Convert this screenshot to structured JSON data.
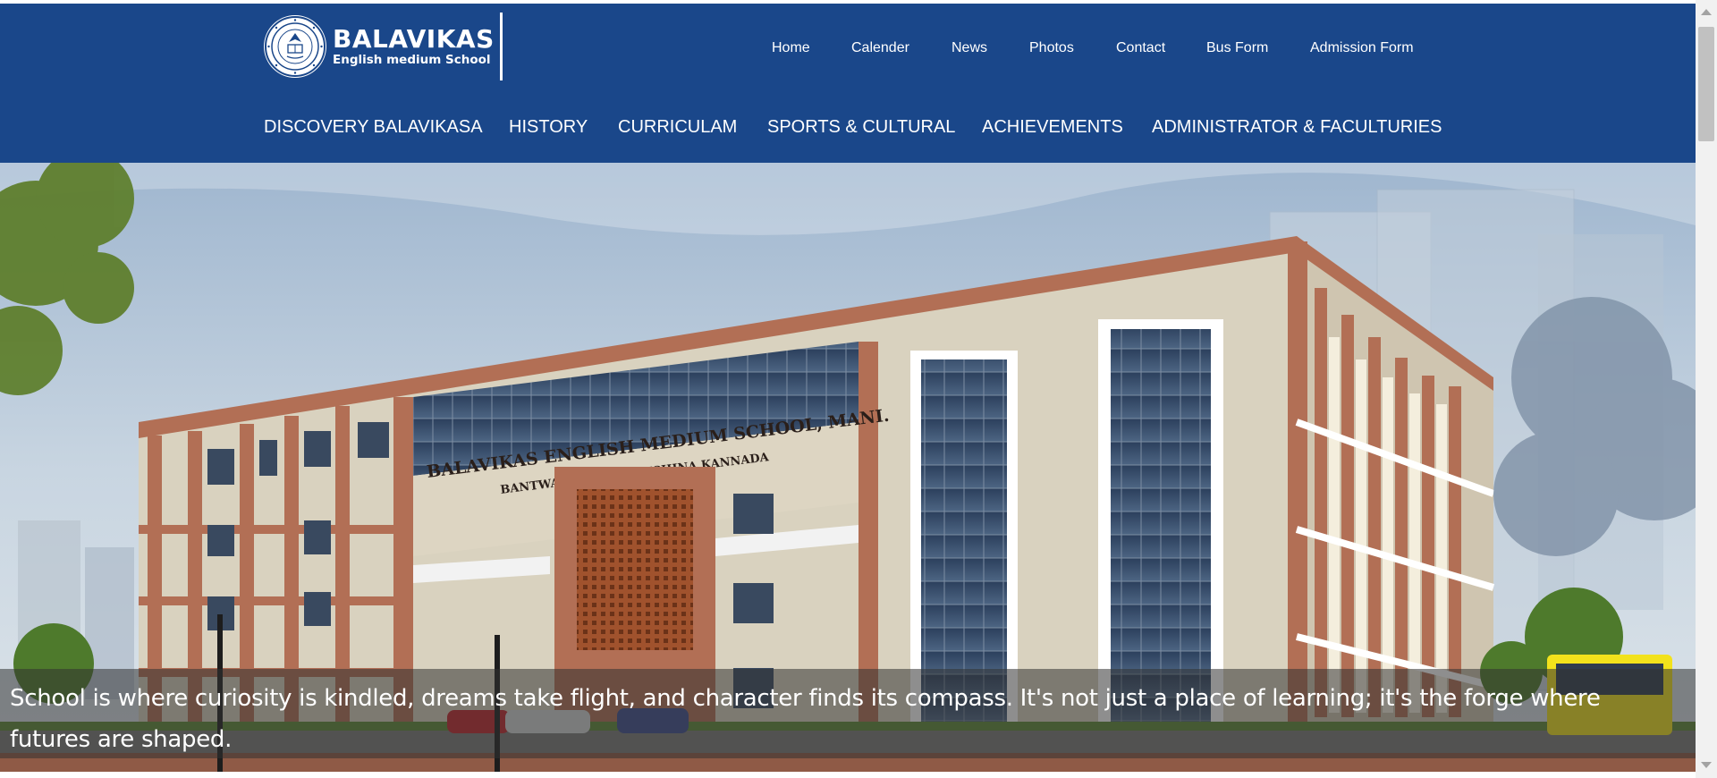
{
  "site": {
    "logo_name": "BALAVIKAS",
    "logo_subtitle": "English medium School"
  },
  "top_nav": [
    {
      "label": "Home"
    },
    {
      "label": "Calender"
    },
    {
      "label": "News"
    },
    {
      "label": "Photos"
    },
    {
      "label": "Contact"
    },
    {
      "label": "Bus Form"
    },
    {
      "label": "Admission Form"
    }
  ],
  "main_nav": [
    {
      "label": "DISCOVERY BALAVIKASA"
    },
    {
      "label": "HISTORY"
    },
    {
      "label": "CURRICULAM"
    },
    {
      "label": "SPORTS & CULTURAL"
    },
    {
      "label": "ACHIEVEMENTS"
    },
    {
      "label": "ADMINISTRATOR & FACULTURIES"
    }
  ],
  "hero": {
    "building_sign_line1": "BALAVIKAS ENGLISH MEDIUM SCHOOL, MANI.",
    "building_sign_line2": "BANTWAL TALUK, DAKSHINA KANNADA",
    "caption": "School is where curiosity is kindled, dreams take flight, and character finds its compass. It's not just a place of learning; it's the forge where futures are shaped."
  },
  "colors": {
    "header_bg": "#1a478a",
    "nav_text": "#ffffff",
    "building_brick": "#b26f55",
    "building_beige": "#d9d2bf"
  }
}
